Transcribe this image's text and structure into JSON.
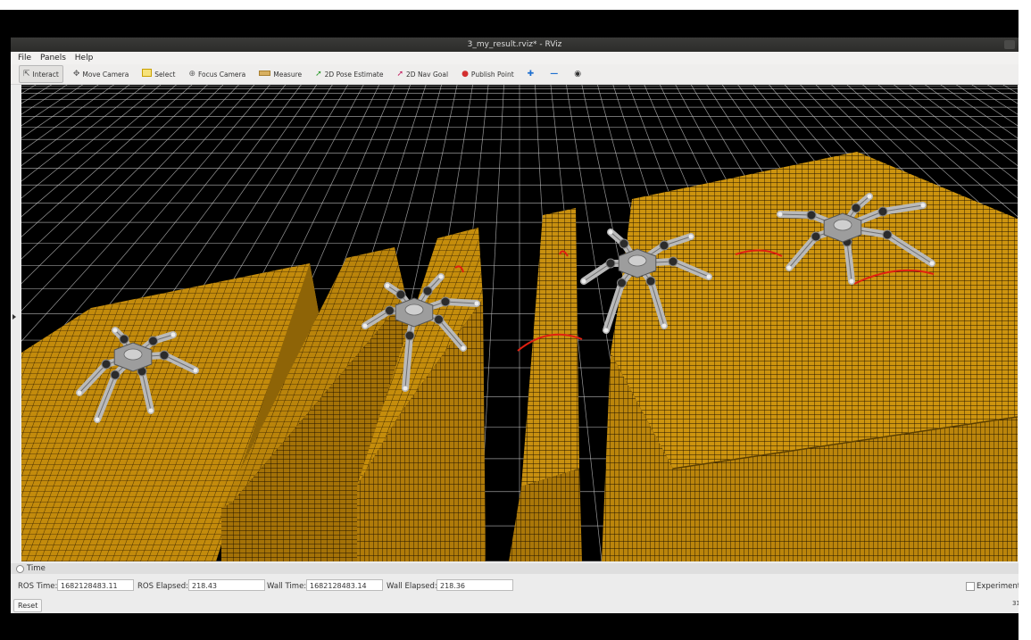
{
  "window": {
    "title": "3_my_result.rviz* - RViz"
  },
  "menu": [
    "File",
    "Panels",
    "Help"
  ],
  "toolbar": {
    "tools": [
      {
        "label": "Interact",
        "icon": "interact-icon",
        "active": true
      },
      {
        "label": "Move Camera",
        "icon": "move-camera-icon"
      },
      {
        "label": "Select",
        "icon": "select-icon"
      },
      {
        "label": "Focus Camera",
        "icon": "focus-camera-icon"
      },
      {
        "label": "Measure",
        "icon": "measure-icon"
      },
      {
        "label": "2D Pose Estimate",
        "icon": "pose-estimate-icon"
      },
      {
        "label": "2D Nav Goal",
        "icon": "nav-goal-icon"
      },
      {
        "label": "Publish Point",
        "icon": "publish-point-icon"
      }
    ],
    "extra_icons": [
      "add-tool-icon",
      "remove-tool-icon",
      "camera-type-icon"
    ]
  },
  "time_panel": {
    "header": "Time",
    "ros_time_label": "ROS Time:",
    "ros_time_value": "1682128483.11",
    "ros_elapsed_label": "ROS Elapsed:",
    "ros_elapsed_value": "218.43",
    "wall_time_label": "Wall Time:",
    "wall_time_value": "1682128483.14",
    "wall_elapsed_label": "Wall Elapsed:",
    "wall_elapsed_value": "218.36",
    "experimental_label": "Experiment",
    "reset_label": "Reset",
    "fps": "31"
  },
  "scene": {
    "background_color": "#000000",
    "terrain_color": "#c8900e",
    "trajectory_color": "#e02010",
    "robot_color": "#b9b9b9"
  }
}
